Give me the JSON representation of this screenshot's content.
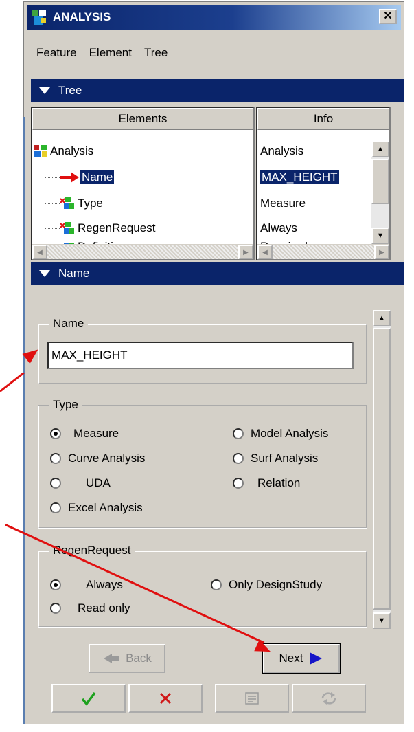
{
  "window": {
    "title": "ANALYSIS"
  },
  "menu": [
    "Feature",
    "Element",
    "Tree"
  ],
  "tree_section": {
    "title": "Tree",
    "columns": {
      "elements": "Elements",
      "info": "Info"
    },
    "items": [
      {
        "label": "Analysis",
        "info": "Analysis",
        "selected": false
      },
      {
        "label": "Name",
        "info": "MAX_HEIGHT",
        "selected": true
      },
      {
        "label": "Type",
        "info": "Measure",
        "selected": false
      },
      {
        "label": "RegenRequest",
        "info": "Always",
        "selected": false
      },
      {
        "label": "Definition",
        "info": "Required",
        "selected": false
      }
    ]
  },
  "name_section": {
    "title": "Name",
    "name_group": {
      "label": "Name",
      "value": "MAX_HEIGHT"
    },
    "type_group": {
      "label": "Type",
      "options": [
        {
          "label": "Measure",
          "checked": true
        },
        {
          "label": "Model Analysis",
          "checked": false
        },
        {
          "label": "Curve Analysis",
          "checked": false
        },
        {
          "label": "Surf Analysis",
          "checked": false
        },
        {
          "label": "UDA",
          "checked": false
        },
        {
          "label": "Relation",
          "checked": false
        },
        {
          "label": "Excel Analysis",
          "checked": false
        }
      ]
    },
    "regen_group": {
      "label": "RegenRequest",
      "options": [
        {
          "label": "Always",
          "checked": true
        },
        {
          "label": "Only DesignStudy",
          "checked": false
        },
        {
          "label": "Read only",
          "checked": false
        }
      ]
    }
  },
  "buttons": {
    "back": "Back",
    "next": "Next",
    "ok_icon": "checkmark-icon",
    "cancel_icon": "x-icon",
    "info_icon": "info-icon",
    "repeat_icon": "repeat-icon"
  },
  "colors": {
    "title_bar": "#0a246a",
    "selection": "#0a246a",
    "annotation_arrow": "#e01010",
    "next_arrow": "#1515c8"
  }
}
